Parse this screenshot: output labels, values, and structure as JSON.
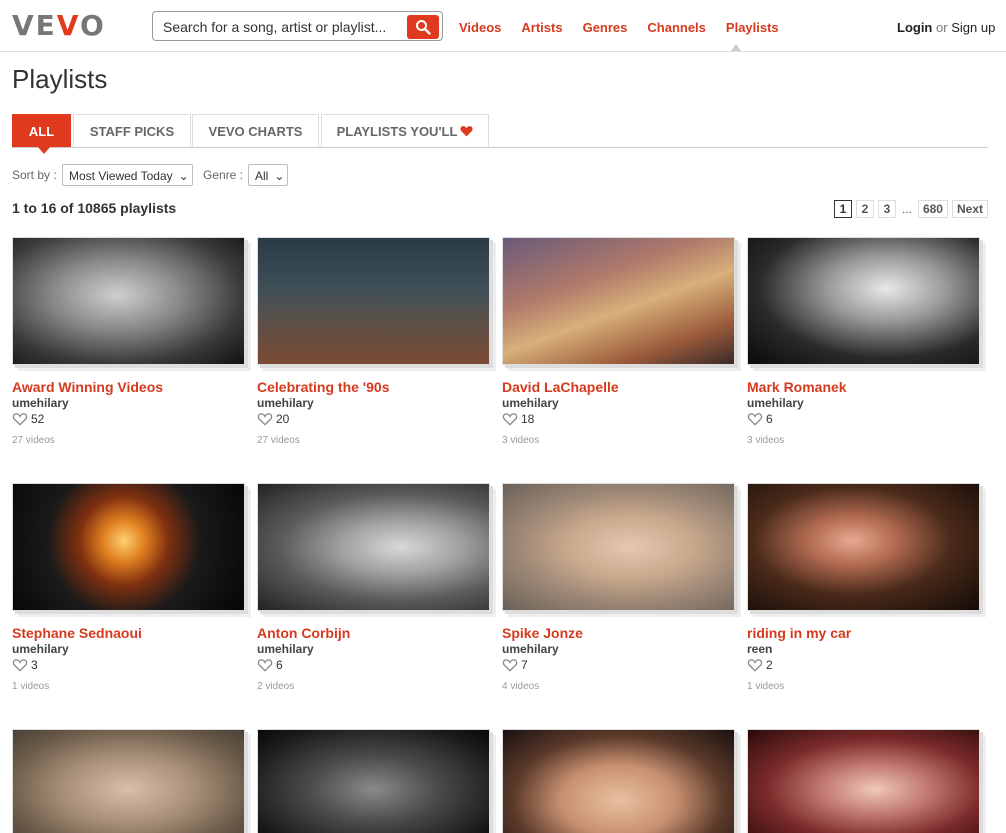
{
  "header": {
    "logo": {
      "left": "VE",
      "red": "V",
      "right": "O"
    },
    "search_placeholder": "Search for a song, artist or playlist...",
    "nav": [
      "Videos",
      "Artists",
      "Genres",
      "Channels",
      "Playlists"
    ],
    "login": "Login",
    "or": "or",
    "signup": "Sign up"
  },
  "page_title": "Playlists",
  "tabs": [
    "ALL",
    "STAFF PICKS",
    "VEVO CHARTS",
    "PLAYLISTS YOU'LL"
  ],
  "sort": {
    "sort_label": "Sort by :",
    "sort_value": "Most Viewed Today",
    "genre_label": "Genre :",
    "genre_value": "All"
  },
  "count_text": "1 to 16 of 10865 playlists",
  "pager": {
    "pages": [
      "1",
      "2",
      "3"
    ],
    "ellipsis": "...",
    "last": "680",
    "next": "Next"
  },
  "colors": {
    "accent": "#e03a1e"
  },
  "playlists": [
    {
      "title": "Award Winning Videos",
      "user": "umehilary",
      "likes": "52",
      "videos": "27 videos"
    },
    {
      "title": "Celebrating the '90s",
      "user": "umehilary",
      "likes": "20",
      "videos": "27 videos"
    },
    {
      "title": "David LaChapelle",
      "user": "umehilary",
      "likes": "18",
      "videos": "3 videos"
    },
    {
      "title": "Mark Romanek",
      "user": "umehilary",
      "likes": "6",
      "videos": "3 videos"
    },
    {
      "title": "Stephane Sednaoui",
      "user": "umehilary",
      "likes": "3",
      "videos": "1 videos"
    },
    {
      "title": "Anton Corbijn",
      "user": "umehilary",
      "likes": "6",
      "videos": "2 videos"
    },
    {
      "title": "Spike Jonze",
      "user": "umehilary",
      "likes": "7",
      "videos": "4 videos"
    },
    {
      "title": "riding in my car",
      "user": "reen",
      "likes": "2",
      "videos": "1 videos"
    }
  ]
}
